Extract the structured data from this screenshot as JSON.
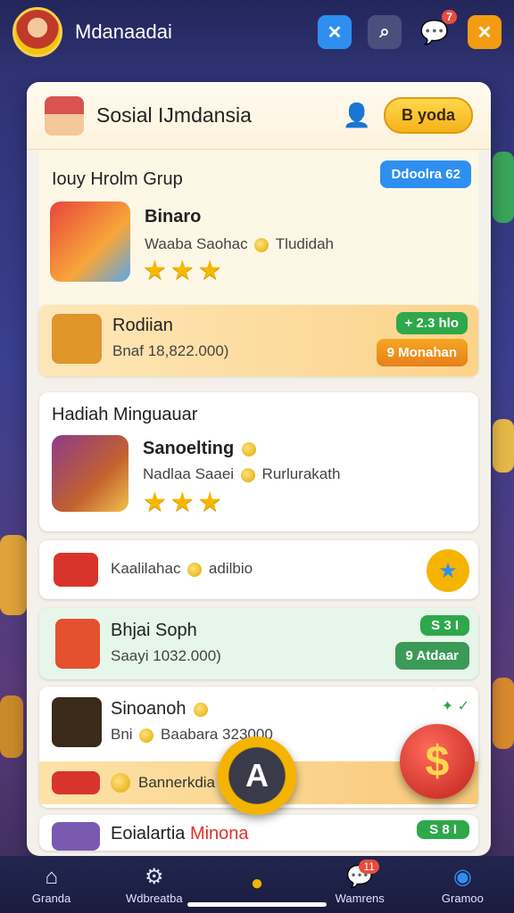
{
  "header": {
    "app_title": "Mdanaadai",
    "icons": [
      "close-x-icon",
      "search-icon",
      "chat-icon",
      "close-icon"
    ],
    "chat_badge": "7"
  },
  "panel": {
    "title": "Sosial IJmdansia",
    "button_label": "B yoda",
    "section1": {
      "title": "Iouy Hrolm Grup",
      "pill": "Ddoolra 62",
      "item_name": "Binaro",
      "item_sub": "Waaba Saohac",
      "item_sub2": "Tludidah",
      "stars": "★★★"
    },
    "strip1": {
      "name": "Rodiian",
      "sub": "Bnaf 18,822.000)",
      "pill_top": "+ 2.3 hlo",
      "pill_bottom": "9 Monahan"
    },
    "section2": {
      "title": "Hadiah Minguauar",
      "item_name": "Sanoelting",
      "item_sub": "Nadlaa Saaei",
      "item_sub2": "Rurlurakath",
      "stars": "★★★"
    },
    "row1": {
      "label": "Kaalilahac",
      "label2": "adilbio"
    },
    "row2": {
      "name": "Bhjai Soph",
      "sub": "Saayi 1032.000)",
      "pill_top": "S 3 I",
      "pill_bottom": "9 Atdaar"
    },
    "row3": {
      "name": "Sinoanoh",
      "sub": "Bni",
      "sub2": "Baabara 323000",
      "strip_label": "Bannerkdia"
    },
    "row4": {
      "name": "Eoialartia",
      "name2": "Minona",
      "pill": "S 8 I"
    }
  },
  "fab": {
    "center_label": "A",
    "dollar_label": "$"
  },
  "nav": {
    "items": [
      {
        "label": "Granda",
        "icon": "home-icon"
      },
      {
        "label": "Wdbreatba",
        "icon": "gear-icon"
      },
      {
        "label": "",
        "icon": "coin-icon"
      },
      {
        "label": "Wamrens",
        "icon": "chat-icon",
        "badge": "11"
      },
      {
        "label": "Gramoo",
        "icon": "location-icon"
      }
    ]
  },
  "colors": {
    "accent": "#f5b21a",
    "blue": "#2f8ff0",
    "green": "#2ea84a",
    "red": "#d9342b"
  }
}
